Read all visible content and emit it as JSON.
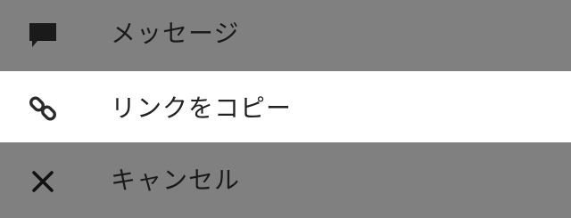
{
  "share_sheet": {
    "items": [
      {
        "label": "メッセージ",
        "icon": "message-icon"
      },
      {
        "label": "リンクをコピー",
        "icon": "link-icon"
      },
      {
        "label": "キャンセル",
        "icon": "close-icon"
      }
    ]
  },
  "colors": {
    "overlay": "#808080",
    "highlight": "#ffffff",
    "text": "#1a1a1a"
  }
}
